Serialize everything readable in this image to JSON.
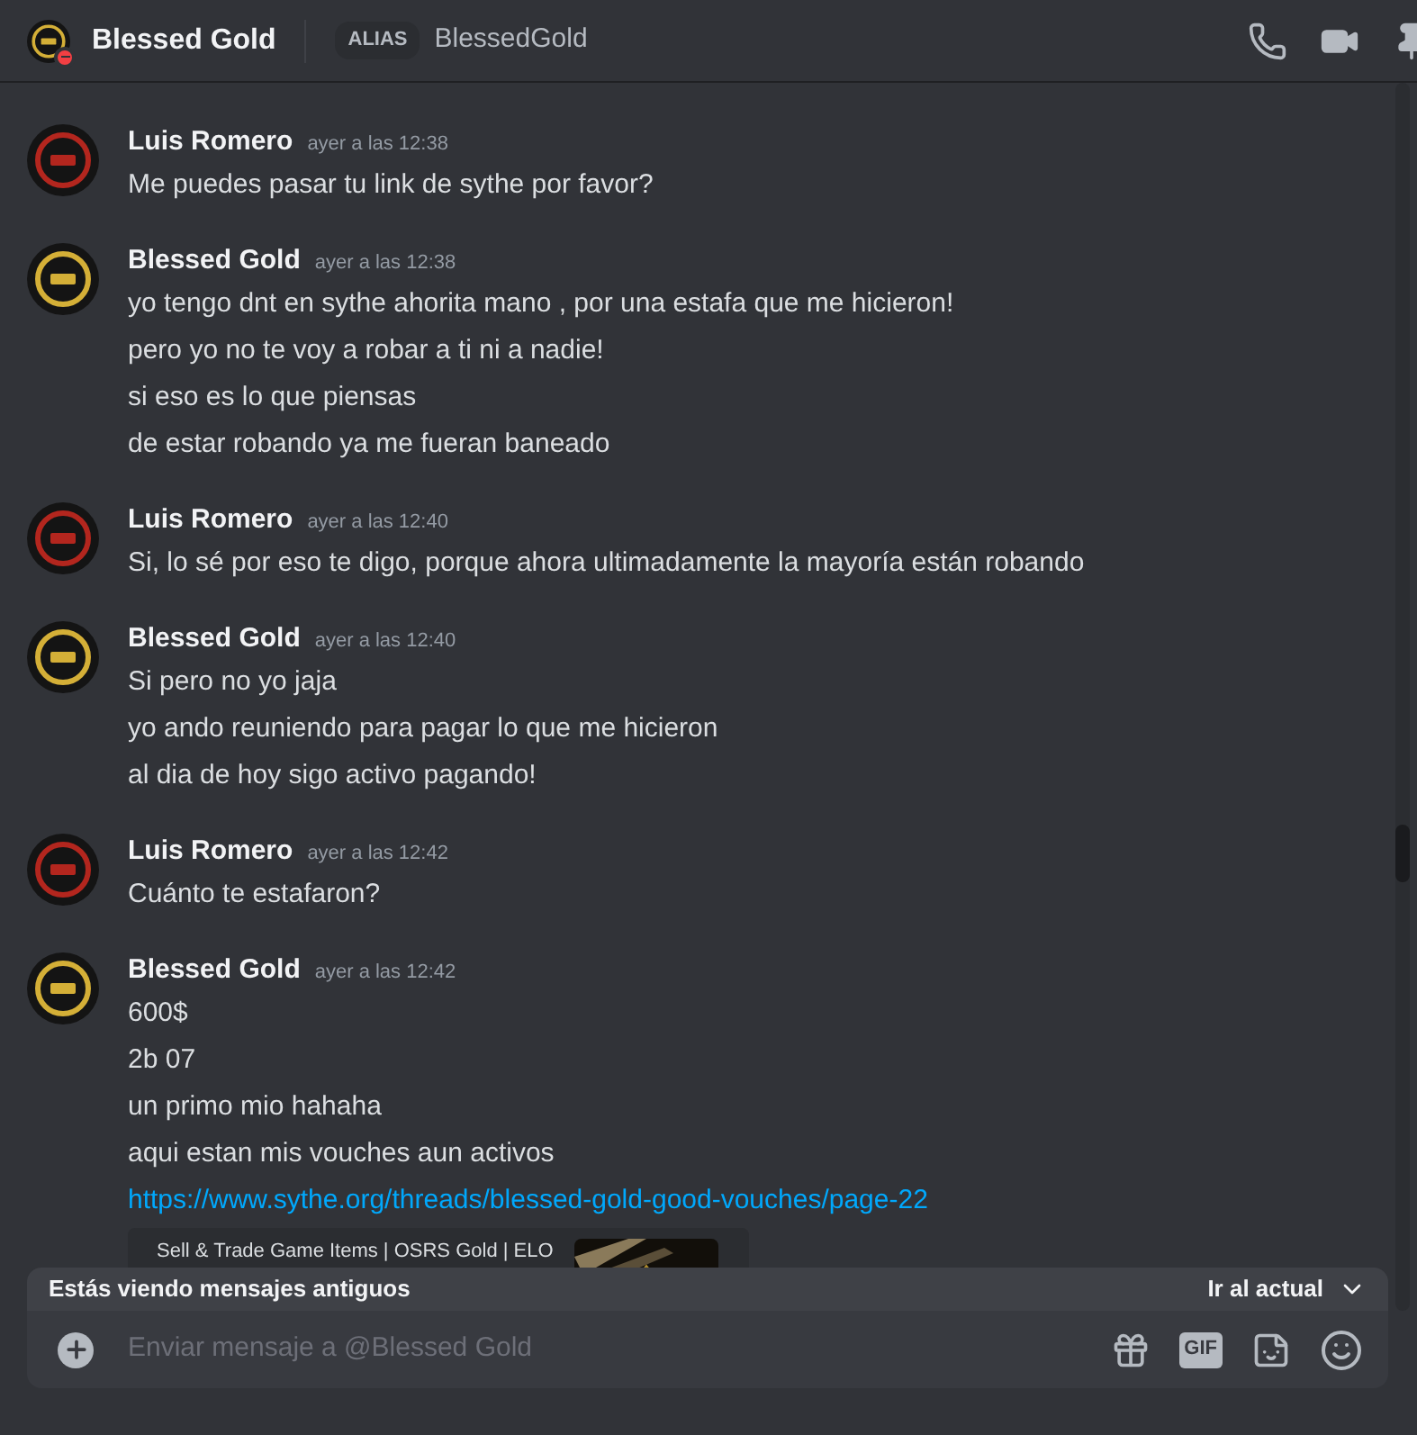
{
  "header": {
    "name": "Blessed Gold",
    "do_not_disturb": true,
    "alias_label": "ALIAS",
    "alias": "BlessedGold"
  },
  "messages": [
    {
      "author": "Luis Romero",
      "color": "#b3261e",
      "time": "ayer a las 12:38",
      "lines": [
        "Me puedes pasar tu link de sythe por favor?"
      ]
    },
    {
      "author": "Blessed Gold",
      "color": "#d4af37",
      "time": "ayer a las 12:38",
      "lines": [
        "yo tengo dnt en sythe ahorita mano , por una estafa que me hicieron!",
        "pero yo no te voy a robar a ti ni a nadie!",
        "si eso es lo que piensas",
        "de estar robando ya me fueran baneado"
      ]
    },
    {
      "author": "Luis Romero",
      "color": "#b3261e",
      "time": "ayer a las 12:40",
      "lines": [
        "Si, lo sé por eso te digo, porque ahora ultimadamente la mayoría están robando"
      ]
    },
    {
      "author": "Blessed Gold",
      "color": "#d4af37",
      "time": "ayer a las 12:40",
      "lines": [
        "Si pero no yo jaja",
        "yo ando reuniendo para pagar lo que me hicieron",
        "al dia de hoy sigo activo pagando!"
      ]
    },
    {
      "author": "Luis Romero",
      "color": "#b3261e",
      "time": "ayer a las 12:42",
      "lines": [
        "Cuánto te estafaron?"
      ]
    },
    {
      "author": "Blessed Gold",
      "color": "#d4af37",
      "time": "ayer a las 12:42",
      "lines": [
        "600$",
        "2b 07",
        "un primo mio hahaha",
        "aqui estan mis vouches aun activos"
      ],
      "link": "https://www.sythe.org/threads/blessed-gold-good-vouches/page-22",
      "embed": {
        "site": "Sell & Trade Game Items | OSRS Gold | ELO"
      }
    }
  ],
  "old_messages_bar": {
    "text": "Estás viendo mensajes antiguos",
    "action": "Ir al actual"
  },
  "composer": {
    "placeholder": "Enviar mensaje a @Blessed Gold",
    "gif_label": "GIF"
  }
}
